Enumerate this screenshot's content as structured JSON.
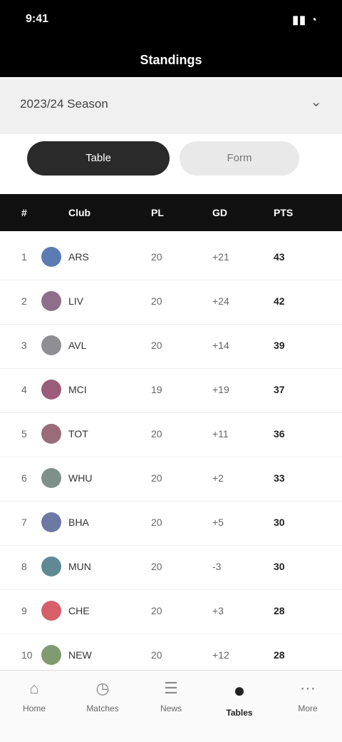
{
  "status": {
    "time": "9:41",
    "icons": "▮▮ ◔"
  },
  "header": {
    "title": "Standings"
  },
  "subheader": {
    "season": "2023/24 Season",
    "chevron": "⌄"
  },
  "segments": [
    "Table",
    "Form"
  ],
  "table": {
    "columns": [
      "#",
      "Club",
      "PL",
      "GD",
      "PTS"
    ],
    "rows": [
      {
        "pos": "1",
        "club": "ARS",
        "pl": "20",
        "gd": "+21",
        "pts": "43",
        "color": "#5b7bb3"
      },
      {
        "pos": "2",
        "club": "LIV",
        "pl": "20",
        "gd": "+24",
        "pts": "42",
        "color": "#8d6f8a"
      },
      {
        "pos": "3",
        "club": "AVL",
        "pl": "20",
        "gd": "+14",
        "pts": "39",
        "color": "#8f8f93"
      },
      {
        "pos": "4",
        "club": "MCI",
        "pl": "19",
        "gd": "+19",
        "pts": "37",
        "color": "#9a5d79"
      },
      {
        "pos": "5",
        "club": "TOT",
        "pl": "20",
        "gd": "+11",
        "pts": "36",
        "color": "#9a6b79"
      },
      {
        "pos": "6",
        "club": "WHU",
        "pl": "20",
        "gd": "+2",
        "pts": "33",
        "color": "#7f8f8a"
      },
      {
        "pos": "7",
        "club": "BHA",
        "pl": "20",
        "gd": "+5",
        "pts": "30",
        "color": "#6c79a5"
      },
      {
        "pos": "8",
        "club": "MUN",
        "pl": "20",
        "gd": "-3",
        "pts": "30",
        "color": "#5f8a95"
      },
      {
        "pos": "9",
        "club": "CHE",
        "pl": "20",
        "gd": "+3",
        "pts": "28",
        "color": "#d65f6b"
      },
      {
        "pos": "10",
        "club": "NEW",
        "pl": "20",
        "gd": "+12",
        "pts": "28",
        "color": "#7f9b6f"
      }
    ]
  },
  "nav": [
    {
      "label": "Home",
      "icon": "⌂",
      "active": false
    },
    {
      "label": "Matches",
      "icon": "◷",
      "active": false
    },
    {
      "label": "News",
      "icon": "☰",
      "active": false
    },
    {
      "label": "Tables",
      "icon": "●",
      "active": true
    },
    {
      "label": "More",
      "icon": "⋯",
      "active": false
    }
  ]
}
